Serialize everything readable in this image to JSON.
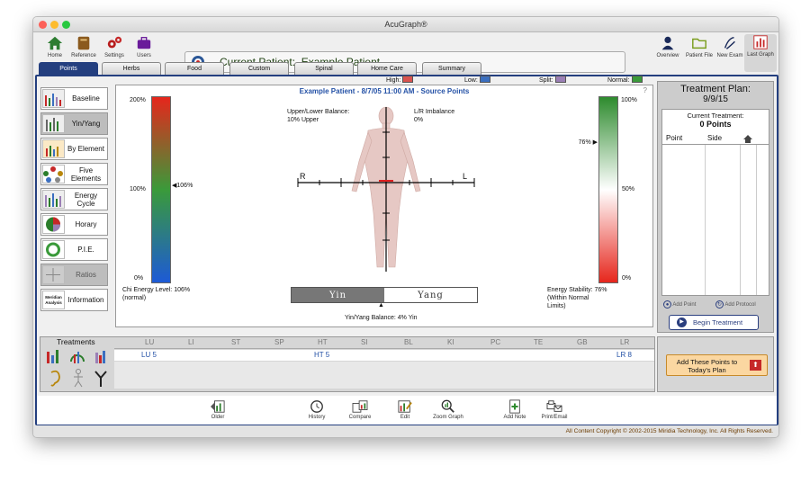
{
  "window": {
    "title": "AcuGraph®"
  },
  "toolbar": {
    "home": "Home",
    "reference": "Reference",
    "settings": "Settings",
    "users": "Users",
    "overview": "Overview",
    "patient_file": "Patient File",
    "new_exam": "New Exam",
    "last_graph": "Last Graph"
  },
  "patient": {
    "label": "Current Patient:",
    "name": "Example Patient"
  },
  "tabs": [
    "Points",
    "Herbs",
    "Food",
    "Custom",
    "Spinal",
    "Home Care",
    "Summary"
  ],
  "legend": {
    "high": "High:",
    "low": "Low:",
    "split": "Split:",
    "normal": "Normal:",
    "colors": {
      "high": "#d9534f",
      "low": "#3b6fc0",
      "split": "#9b7fb6",
      "normal": "#3a9a3a"
    }
  },
  "sidebar": [
    "Baseline",
    "Yin/Yang",
    "By Element",
    "Five Elements",
    "Energy Cycle",
    "Horary",
    "P.I.E.",
    "Ratios",
    "Information"
  ],
  "meridian_analysis": "Meridian Analysis",
  "chart": {
    "title": "Example Patient - 8/7/05 11:00 AM - Source Points",
    "help": "?",
    "left_top": "200%",
    "left_mid": "100%",
    "left_bot": "0%",
    "left_marker": "106%",
    "right_top": "100%",
    "right_mid": "50%",
    "right_bot": "0%",
    "right_marker": "76%",
    "upper_lower": "Upper/Lower Balance:",
    "upper_lower_val": "10% Upper",
    "lr_imbalance": "L/R Imbalance",
    "lr_val": "0%",
    "r": "R",
    "l": "L",
    "chi_energy": "Chi Energy Level: 106%",
    "chi_note": "(normal)",
    "yin": "Yin",
    "yang": "Yang",
    "yin_yang_balance": "Yin/Yang Balance: 4% Yin",
    "stability": "Energy Stability: 76%",
    "stability_note1": "(Within Normal",
    "stability_note2": "Limits)",
    "chi_energy_pct": 106,
    "stability_pct": 76
  },
  "treatment_plan": {
    "title": "Treatment Plan:",
    "date": "9/9/15",
    "current": "Current Treatment:",
    "points": "0 Points",
    "col_point": "Point",
    "col_side": "Side",
    "add_point": "Add Point",
    "add_protocol": "Add Protocol",
    "begin": "Begin Treatment"
  },
  "treatments": {
    "title": "Treatments",
    "meridians": [
      "LU",
      "LI",
      "ST",
      "SP",
      "HT",
      "SI",
      "BL",
      "KI",
      "PC",
      "TE",
      "GB",
      "LR"
    ],
    "points": {
      "lu": "LU 5",
      "ht": "HT 5",
      "lr": "LR 8"
    }
  },
  "add_points": "Add These Points to Today's Plan",
  "bottom": [
    "Older",
    "History",
    "Compare",
    "Edit",
    "Zoom Graph",
    "Add Note",
    "Print/Email"
  ],
  "footer": "All Content Copyright © 2002-2015 Miridia Technology, Inc.  All Rights Reserved."
}
